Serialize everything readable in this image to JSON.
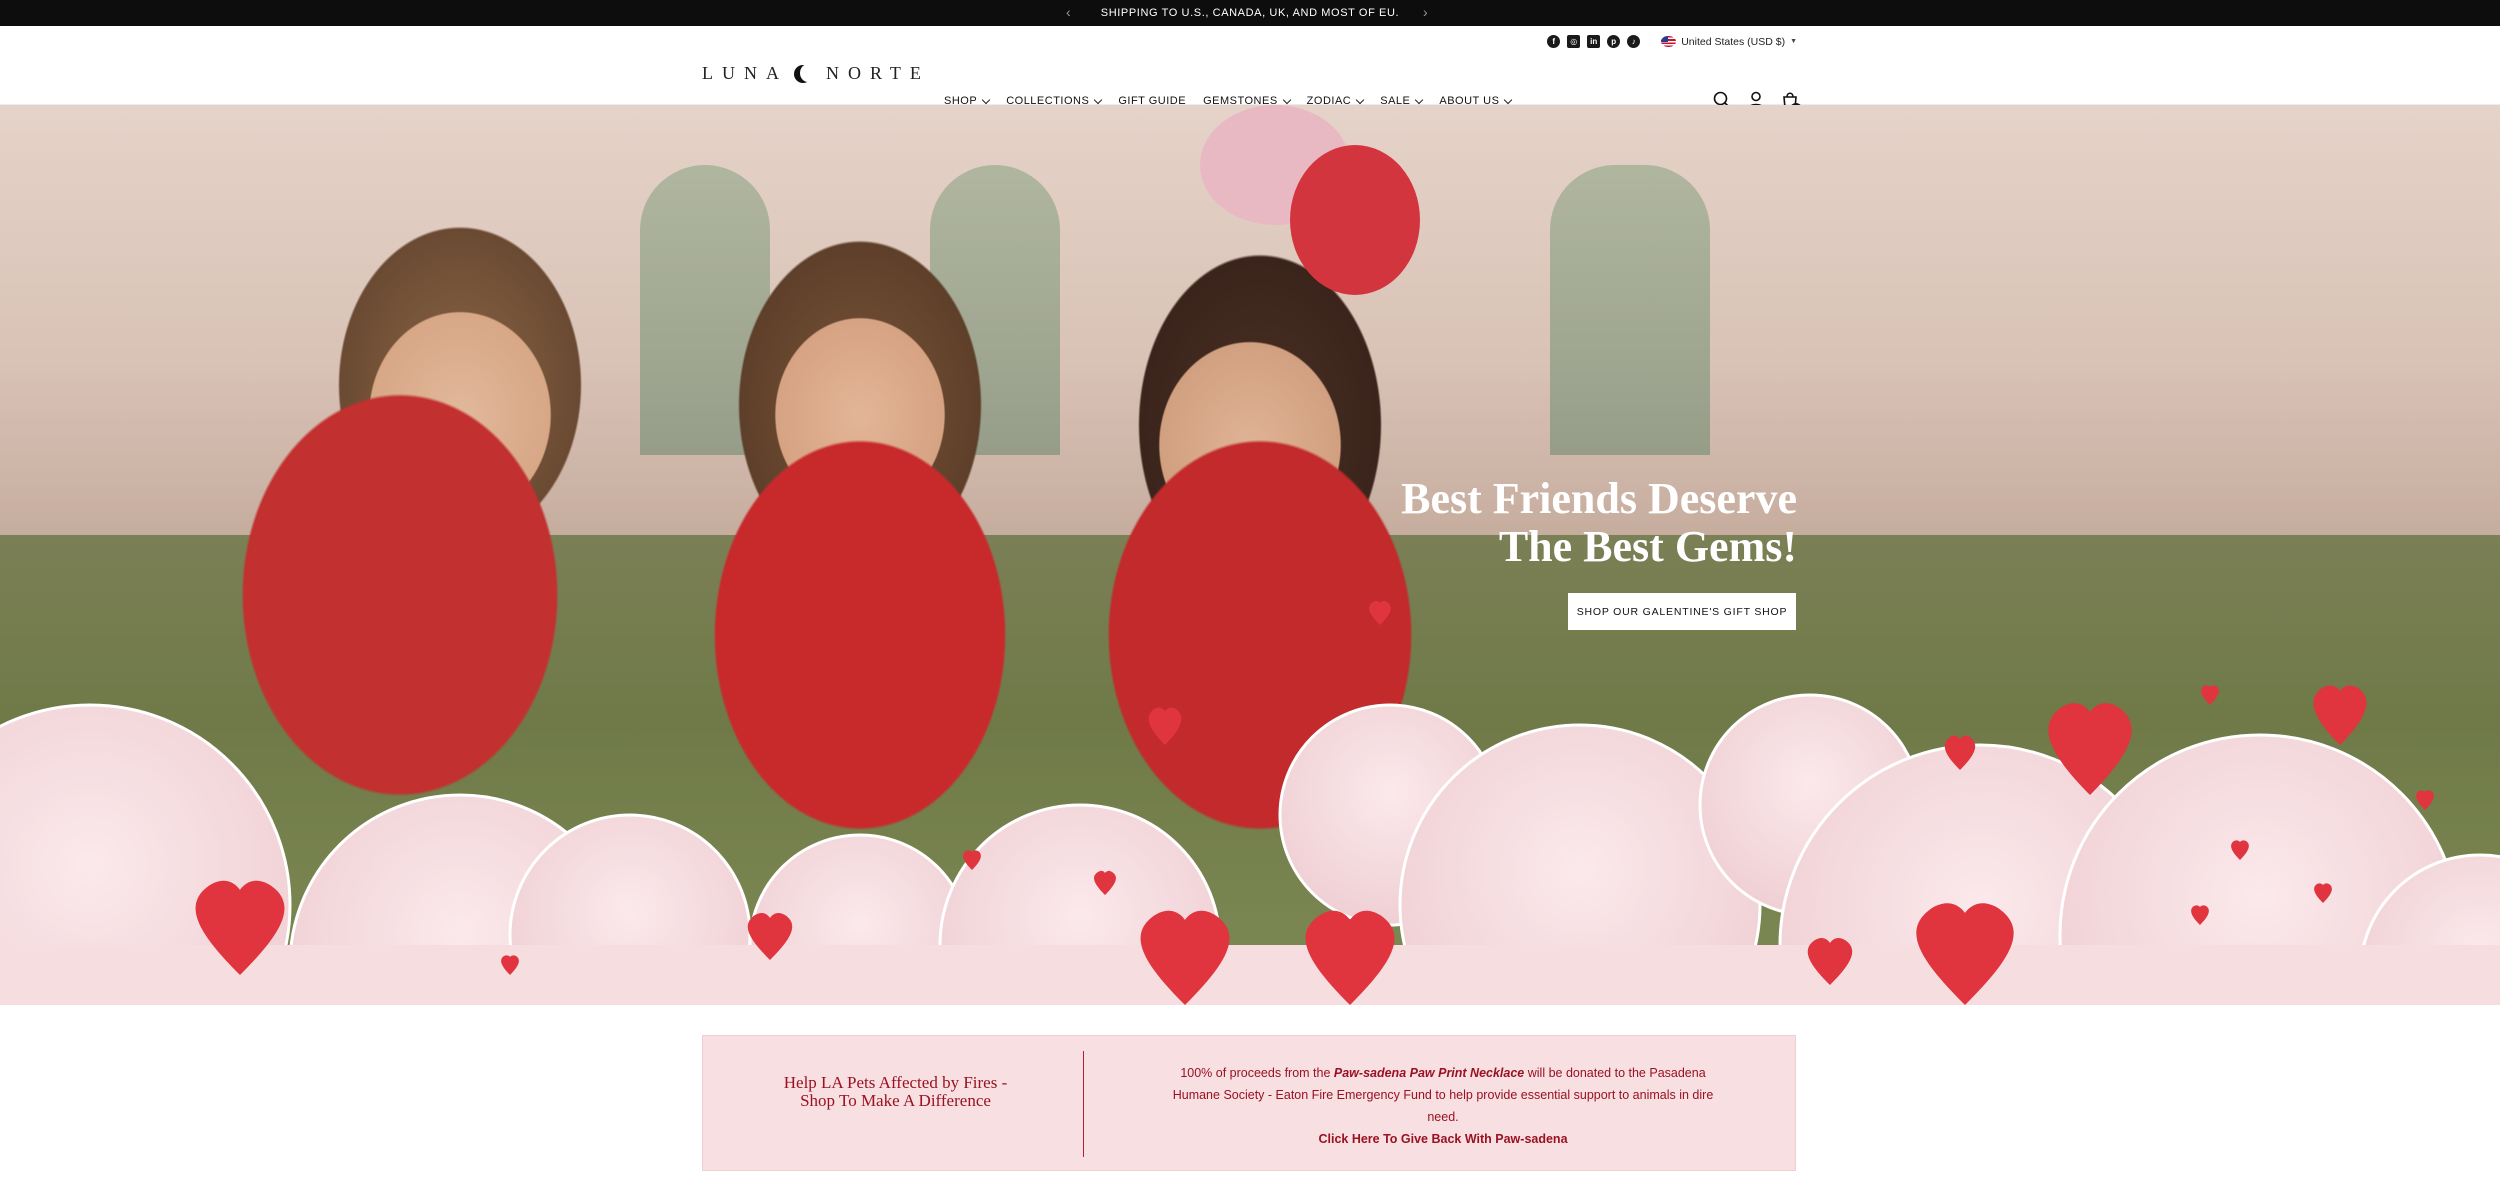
{
  "announcement": {
    "message": "SHIPPING TO U.S., CANADA, UK, AND MOST OF EU.",
    "prev_icon": "chevron-left-icon",
    "next_icon": "chevron-right-icon"
  },
  "header": {
    "social": [
      {
        "name": "facebook-icon",
        "glyph": "f"
      },
      {
        "name": "instagram-icon",
        "glyph": "◎"
      },
      {
        "name": "linkedin-icon",
        "glyph": "in"
      },
      {
        "name": "pinterest-icon",
        "glyph": "p"
      },
      {
        "name": "tiktok-icon",
        "glyph": "♪"
      }
    ],
    "country": "United States (USD $)",
    "logo_left": "LUNA",
    "logo_right": "NORTE",
    "nav": [
      {
        "label": "SHOP",
        "dropdown": true
      },
      {
        "label": "COLLECTIONS",
        "dropdown": true
      },
      {
        "label": "GIFT GUIDE",
        "dropdown": false
      },
      {
        "label": "GEMSTONES",
        "dropdown": true
      },
      {
        "label": "ZODIAC",
        "dropdown": true
      },
      {
        "label": "SALE",
        "dropdown": true
      },
      {
        "label": "ABOUT US",
        "dropdown": true
      }
    ],
    "cart_count": "0"
  },
  "hero": {
    "title_line1": "Best Friends Deserve",
    "title_line2": "The Best Gems!",
    "button": "SHOP OUR GALENTINE'S GIFT SHOP"
  },
  "donation": {
    "heading": "Help LA Pets Affected by Fires - Shop To Make A Difference",
    "text_prefix": "100% of proceeds from the ",
    "product": "Paw-sadena Paw Print Necklace",
    "text_suffix": " will be donated to the Pasadena Humane Society - Eaton Fire Emergency Fund to help provide essential support to animals in dire need.",
    "cta": "Click Here To Give Back With Paw-sadena"
  },
  "colors": {
    "announcement_bg": "#0d0d0d",
    "donation_bg": "#f7dfe2",
    "donation_text": "#9a1221",
    "cloud_pink": "#f6dde0",
    "heart_red": "#e0343f"
  }
}
